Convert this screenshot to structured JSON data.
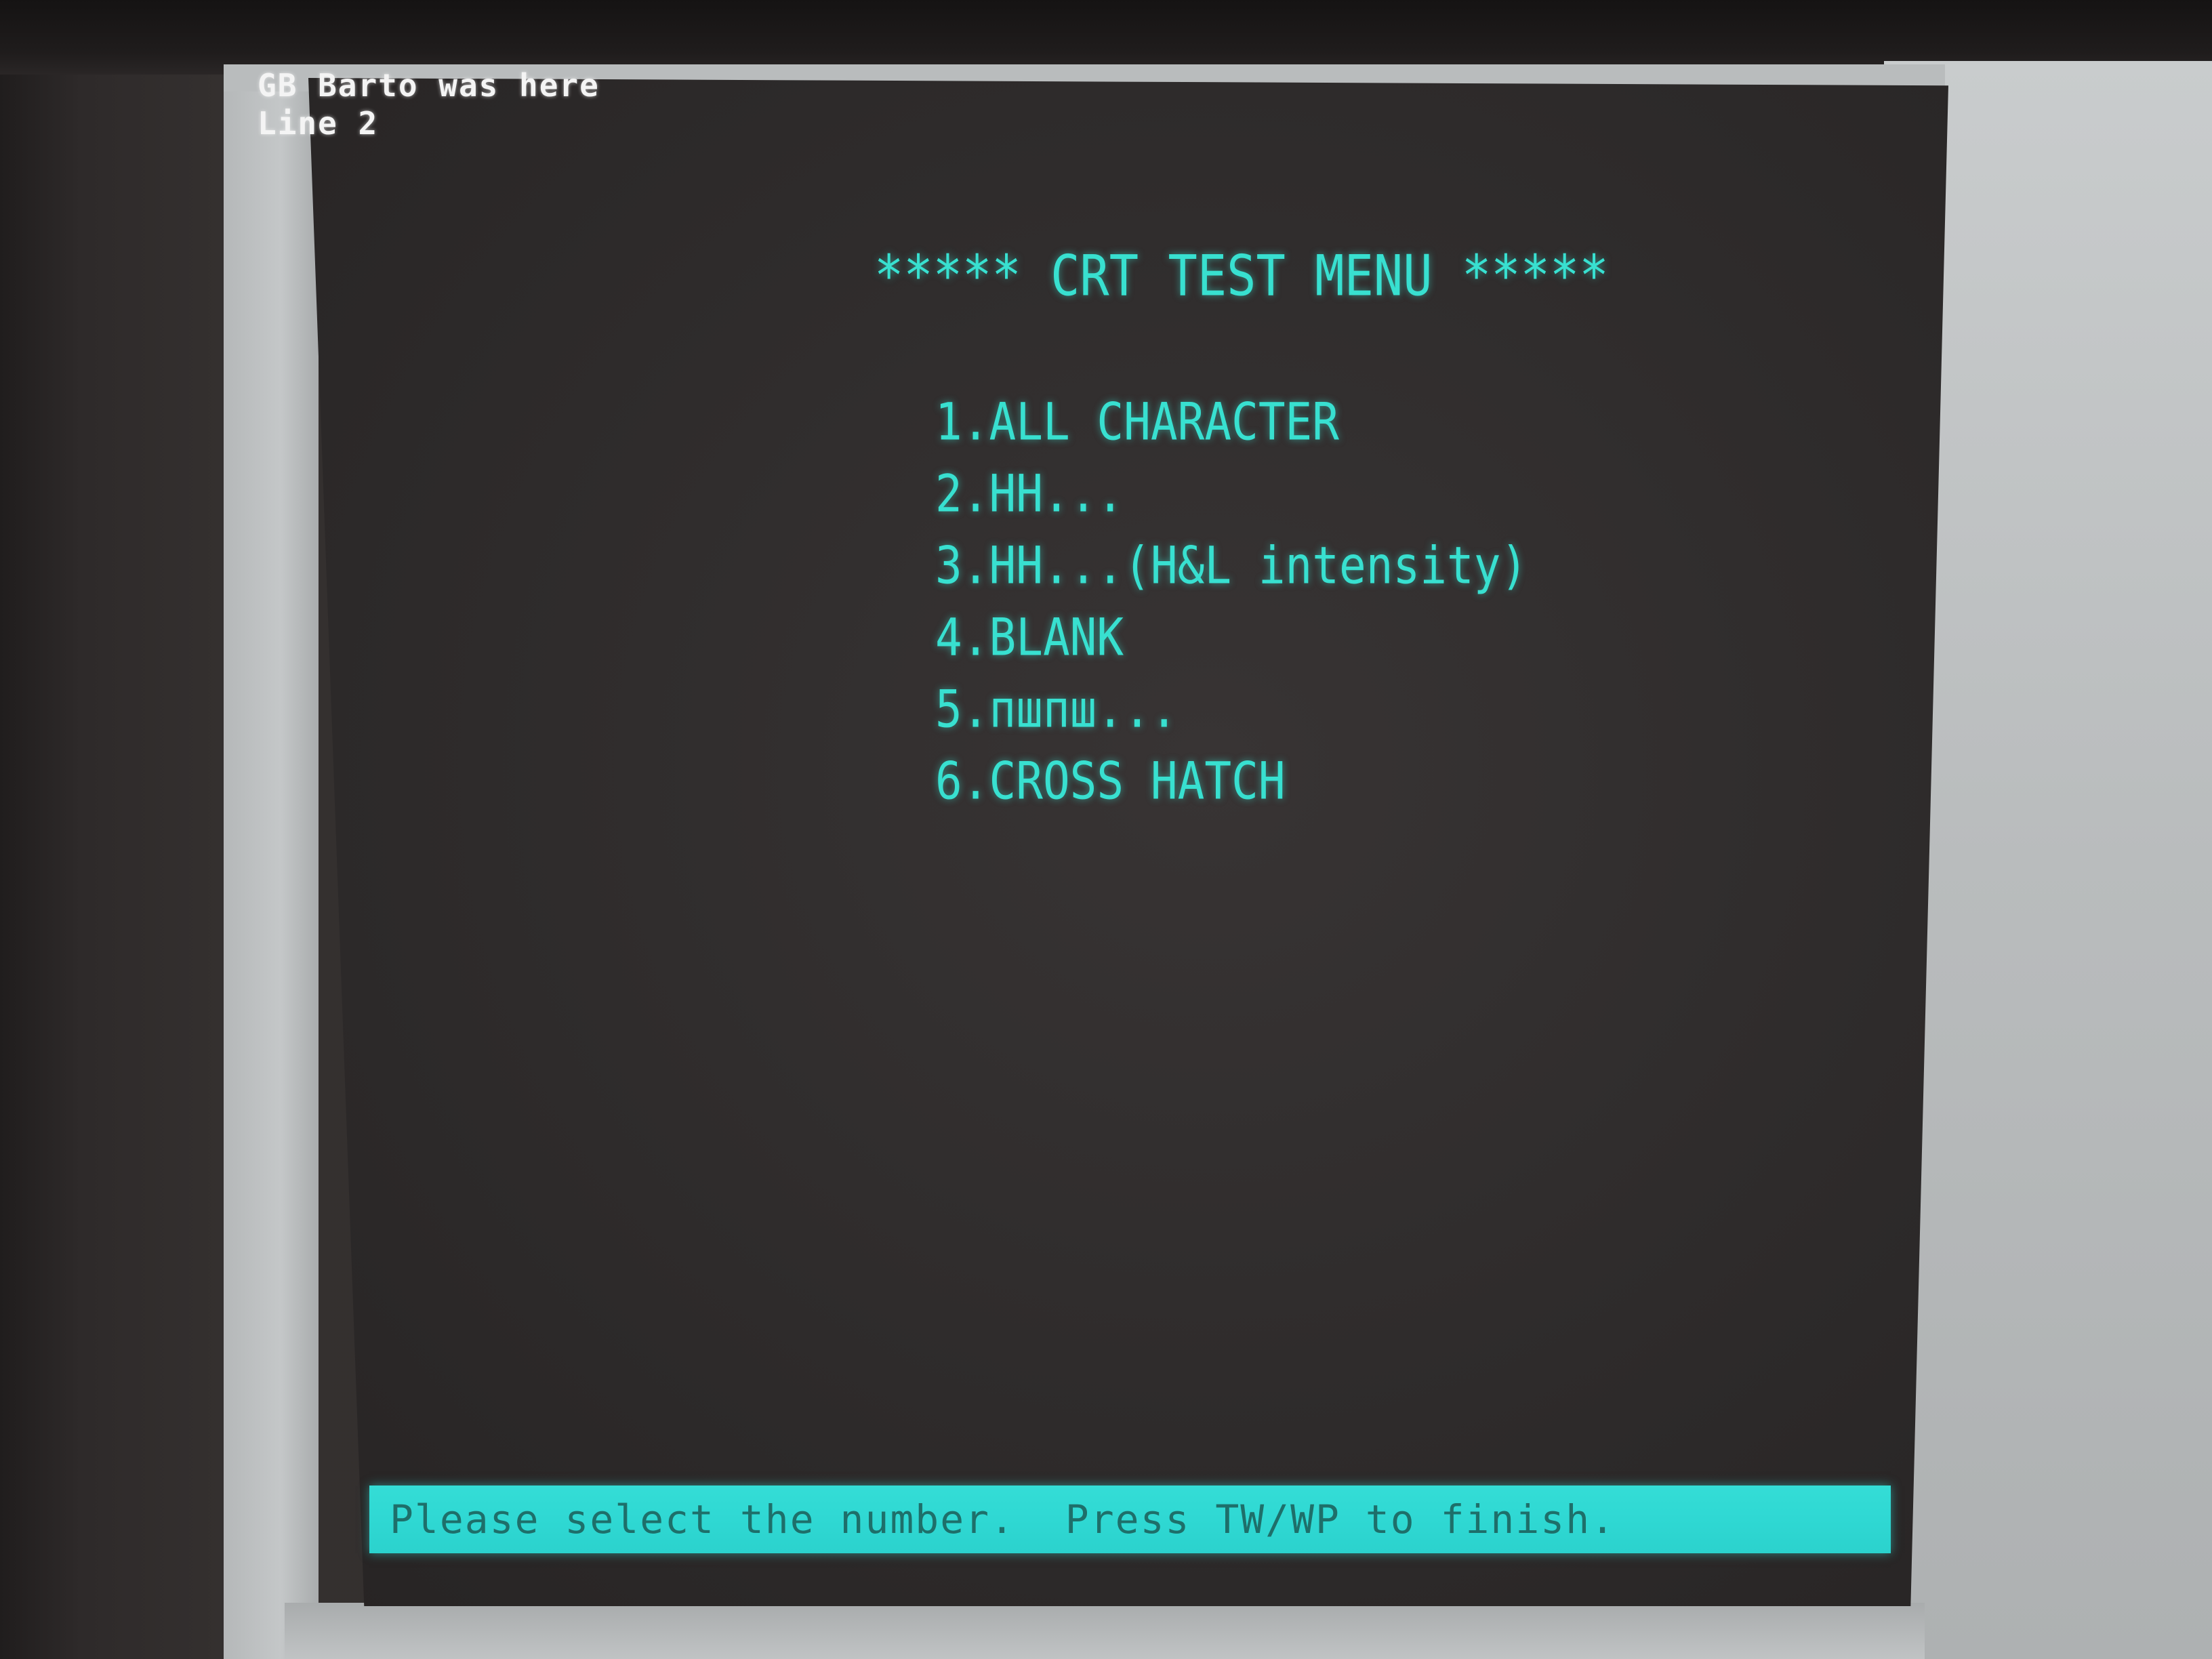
{
  "overlay": {
    "line1": "GB Barto was here",
    "line2": "Line 2"
  },
  "menu": {
    "title": "***** CRT TEST MENU *****",
    "items": [
      "1.ALL CHARACTER",
      "2.HH...",
      "3.HH...(H&L intensity)",
      "4.BLANK",
      "5.пшпш...",
      "6.CROSS HATCH"
    ]
  },
  "status": {
    "message": "Please select the number.  Press TW/WP to finish."
  },
  "colors": {
    "screen_text": "#38e0d0",
    "status_bar": "#2fd8d3",
    "status_text": "#1e6f6a",
    "crt_background": "#302d2d"
  }
}
